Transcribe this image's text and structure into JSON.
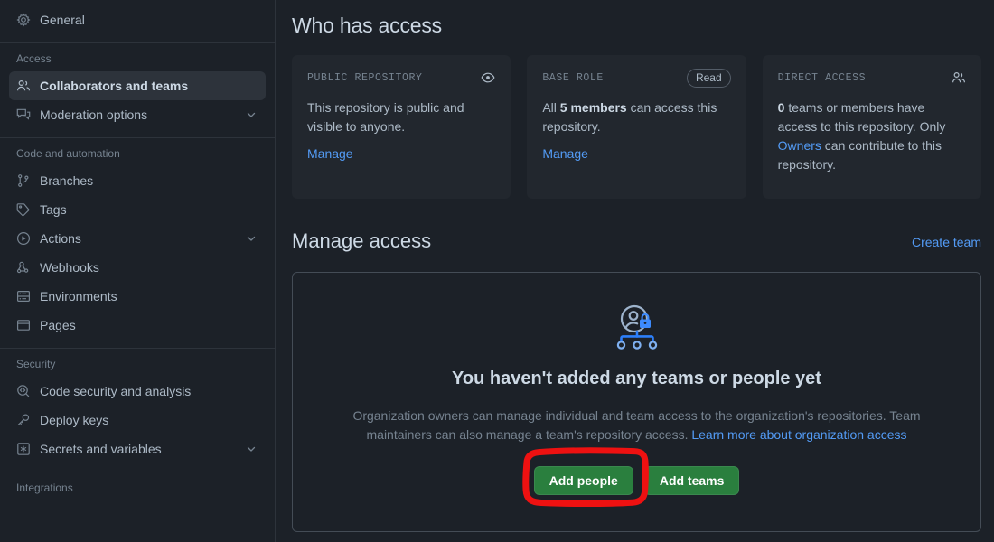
{
  "sidebar": {
    "top_items": [
      {
        "label": "General",
        "icon": "gear-icon",
        "active": false,
        "chevron": false
      }
    ],
    "groups": [
      {
        "title": "Access",
        "items": [
          {
            "label": "Collaborators and teams",
            "icon": "people-icon",
            "active": true,
            "chevron": false
          },
          {
            "label": "Moderation options",
            "icon": "comment-discussion-icon",
            "active": false,
            "chevron": true
          }
        ]
      },
      {
        "title": "Code and automation",
        "items": [
          {
            "label": "Branches",
            "icon": "git-branch-icon",
            "active": false,
            "chevron": false
          },
          {
            "label": "Tags",
            "icon": "tag-icon",
            "active": false,
            "chevron": false
          },
          {
            "label": "Actions",
            "icon": "play-icon",
            "active": false,
            "chevron": true
          },
          {
            "label": "Webhooks",
            "icon": "webhook-icon",
            "active": false,
            "chevron": false
          },
          {
            "label": "Environments",
            "icon": "server-icon",
            "active": false,
            "chevron": false
          },
          {
            "label": "Pages",
            "icon": "browser-icon",
            "active": false,
            "chevron": false
          }
        ]
      },
      {
        "title": "Security",
        "items": [
          {
            "label": "Code security and analysis",
            "icon": "codescan-icon",
            "active": false,
            "chevron": false
          },
          {
            "label": "Deploy keys",
            "icon": "key-icon",
            "active": false,
            "chevron": false
          },
          {
            "label": "Secrets and variables",
            "icon": "asterisk-box-icon",
            "active": false,
            "chevron": true
          }
        ]
      },
      {
        "title": "Integrations",
        "items": []
      }
    ]
  },
  "main": {
    "who_has_access_title": "Who has access",
    "cards": [
      {
        "label": "PUBLIC REPOSITORY",
        "icon": "eye-icon",
        "badge": null,
        "body_html": "This repository is public and visible to anyone.",
        "action_label": "Manage"
      },
      {
        "label": "BASE ROLE",
        "icon": null,
        "badge": "Read",
        "body_prefix": "All ",
        "body_bold": "5 members",
        "body_suffix": " can access this repository.",
        "action_label": "Manage"
      },
      {
        "label": "DIRECT ACCESS",
        "icon": "people-icon",
        "badge": null,
        "body_bold": "0",
        "body_mid": " teams or members have access to this repository. Only ",
        "body_link": "Owners",
        "body_end": " can contribute to this repository.",
        "action_label": null
      }
    ],
    "manage_access_title": "Manage access",
    "create_team_label": "Create team",
    "blankslate": {
      "icon": "org-access-icon",
      "title": "You haven't added any teams or people yet",
      "description_part1": "Organization owners can manage individual and team access to the organization's repositories. Team maintainers can also manage a team's repository access. ",
      "description_link": "Learn more about organization access",
      "add_people_label": "Add people",
      "add_teams_label": "Add teams"
    }
  },
  "annotation": {
    "shape": "hand-drawn-rounded-rectangle",
    "target": "Add people",
    "color": "#ee1111"
  },
  "colors": {
    "page_bg": "#1c2128",
    "card_bg": "#22272e",
    "accent_link": "#539bf5",
    "button_green": "#2a7f3e",
    "border": "#444c56",
    "annotation_red": "#ee1111"
  }
}
